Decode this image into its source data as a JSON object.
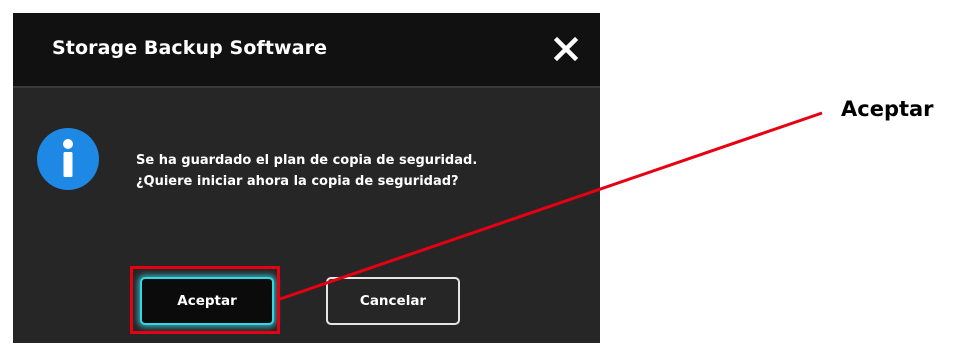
{
  "dialog": {
    "title": "Storage Backup Software",
    "close_icon": "close-icon",
    "info_icon": "info-icon",
    "message_line1": "Se ha guardado el plan de copia de seguridad.",
    "message_line2": "¿Quiere iniciar ahora la copia de seguridad?",
    "accept_label": "Aceptar",
    "cancel_label": "Cancelar"
  },
  "annotation": {
    "label": "Aceptar",
    "color": "#e60012"
  },
  "colors": {
    "titlebar": "#111111",
    "body": "#262626",
    "info_blue": "#1e88e5",
    "focus_glow": "#35d5e6"
  }
}
